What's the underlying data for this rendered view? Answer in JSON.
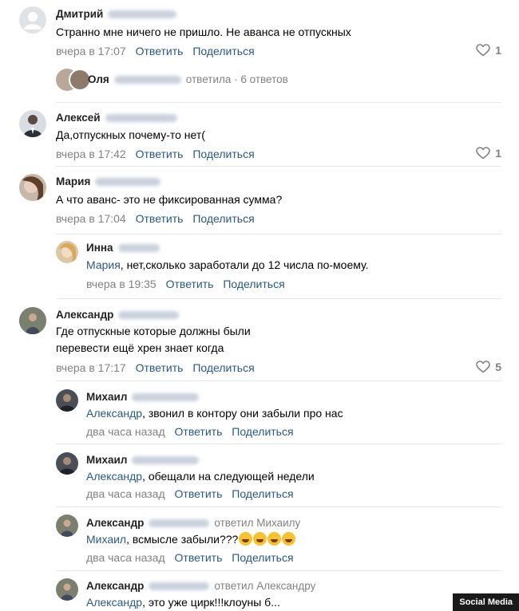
{
  "comments": [
    {
      "name": "Дмитрий",
      "text": "Странно мне ничего не пришло. Не аванса не отпускных",
      "time": "вчера в 17:07",
      "reply": "Ответить",
      "share": "Поделиться",
      "likes": "1"
    },
    {
      "name": "Алексей",
      "text": "Да,отпускных почему-то нет(",
      "time": "вчера в 17:42",
      "reply": "Ответить",
      "share": "Поделиться",
      "likes": "1"
    },
    {
      "name": "Мария",
      "text": "А что аванс- это не фиксированная сумма?",
      "time": "вчера в 17:04",
      "reply": "Ответить",
      "share": "Поделиться"
    },
    {
      "name": "Инна",
      "mention": "Мария",
      "text": ", нет,сколько заработали до 12 числа по-моему.",
      "time": "вчера в 19:35",
      "reply": "Ответить",
      "share": "Поделиться"
    },
    {
      "name": "Александр",
      "text_line1": "Где отпускные которые должны были",
      "text_line2": "перевести ещё хрен знает когда",
      "time": "вчера в 17:17",
      "reply": "Ответить",
      "share": "Поделиться",
      "likes": "5"
    },
    {
      "name": "Михаил",
      "mention": "Александр",
      "text": ", звонил в контору они забыли про нас",
      "time": "два часа назад",
      "reply": "Ответить",
      "share": "Поделиться"
    },
    {
      "name": "Михаил",
      "mention": "Александр",
      "text": ", обещали на следующей недели",
      "time": "два часа назад",
      "reply": "Ответить",
      "share": "Поделиться"
    },
    {
      "name": "Александр",
      "replied_to": "ответил Михаилу",
      "mention": "Михаил",
      "text": ", всмысле забыли???",
      "time": "два часа назад",
      "reply": "Ответить",
      "share": "Поделиться"
    },
    {
      "name": "Александр",
      "replied_to": "ответил Александру",
      "mention": "Александр",
      "text": ", это уже цирк!!!клоуны б..."
    }
  ],
  "thread": {
    "name": "Оля",
    "summary": "ответила · 6 ответов"
  },
  "watermark": "Social Media",
  "icons": {
    "like": "heart-icon",
    "emoji": "laughing-emoji-icon"
  }
}
